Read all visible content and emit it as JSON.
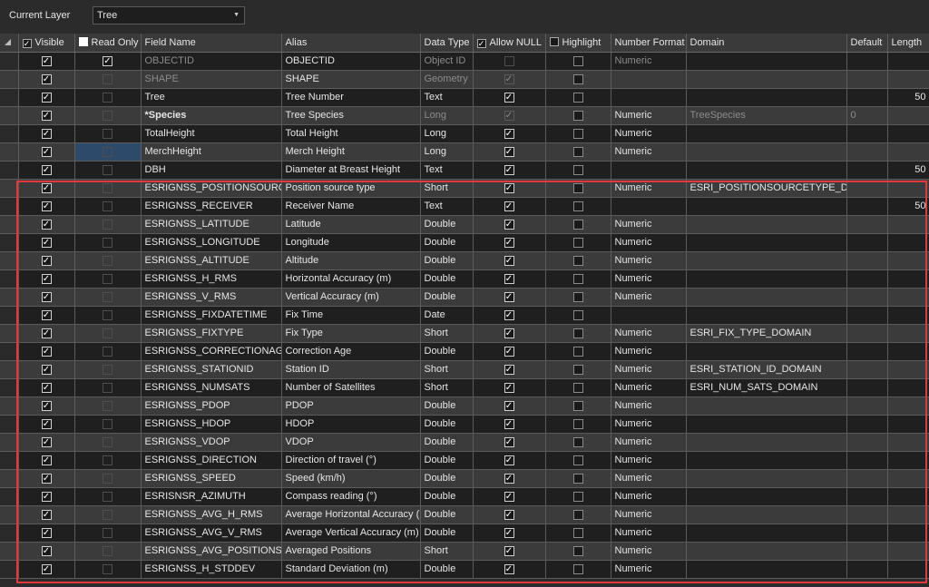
{
  "toolbar": {
    "current_layer_label": "Current Layer",
    "layer_value": "Tree",
    "dropdown_icon": "chevron-down-icon"
  },
  "columns": [
    {
      "key": "visible",
      "label": "Visible",
      "checkbox": "checked"
    },
    {
      "key": "readonly",
      "label": "Read Only",
      "checkbox": "filled"
    },
    {
      "key": "field",
      "label": "Field Name"
    },
    {
      "key": "alias",
      "label": "Alias"
    },
    {
      "key": "type",
      "label": "Data Type"
    },
    {
      "key": "allownull",
      "label": "Allow NULL",
      "checkbox": "checked"
    },
    {
      "key": "highlight",
      "label": "Highlight",
      "checkbox": "empty"
    },
    {
      "key": "numfmt",
      "label": "Number Format"
    },
    {
      "key": "domain",
      "label": "Domain"
    },
    {
      "key": "default",
      "label": "Default"
    },
    {
      "key": "length",
      "label": "Length"
    }
  ],
  "rows": [
    {
      "visible": true,
      "readonly": true,
      "readonly_disabled": false,
      "field": "OBJECTID",
      "field_muted": true,
      "alias": "OBJECTID",
      "type": "Object ID",
      "type_muted": true,
      "allownull": false,
      "allownull_disabled": true,
      "highlight": false,
      "numfmt": "Numeric",
      "numfmt_muted": true,
      "domain": "",
      "default": "",
      "length": ""
    },
    {
      "visible": true,
      "readonly": false,
      "readonly_disabled": true,
      "field": "SHAPE",
      "field_muted": true,
      "alias": "SHAPE",
      "type": "Geometry",
      "type_muted": true,
      "allownull": true,
      "allownull_disabled": true,
      "highlight": false,
      "numfmt": "",
      "domain": "",
      "default": "",
      "length": ""
    },
    {
      "visible": true,
      "readonly": false,
      "readonly_disabled": true,
      "field": "Tree",
      "alias": "Tree Number",
      "type": "Text",
      "allownull": true,
      "highlight": false,
      "numfmt": "",
      "domain": "",
      "default": "",
      "length": "50"
    },
    {
      "visible": true,
      "readonly": false,
      "readonly_disabled": true,
      "field": "*Species",
      "field_bold": true,
      "alias": "Tree Species",
      "type": "Long",
      "type_muted": true,
      "allownull": true,
      "allownull_disabled": true,
      "highlight": false,
      "numfmt": "Numeric",
      "domain": "TreeSpecies",
      "domain_muted": true,
      "default": "0",
      "default_muted": true,
      "length": ""
    },
    {
      "visible": true,
      "readonly": false,
      "readonly_disabled": true,
      "field": "TotalHeight",
      "alias": "Total Height",
      "type": "Long",
      "allownull": true,
      "highlight": false,
      "numfmt": "Numeric",
      "domain": "",
      "default": "",
      "length": ""
    },
    {
      "visible": true,
      "readonly": false,
      "readonly_disabled": true,
      "readonly_highlight": true,
      "field": "MerchHeight",
      "alias": "Merch Height",
      "type": "Long",
      "allownull": true,
      "highlight": false,
      "numfmt": "Numeric",
      "domain": "",
      "default": "",
      "length": ""
    },
    {
      "visible": true,
      "readonly": false,
      "readonly_disabled": true,
      "field": "DBH",
      "alias": "Diameter at Breast Height",
      "type": "Text",
      "allownull": true,
      "highlight": false,
      "numfmt": "",
      "domain": "",
      "default": "",
      "length": "50"
    },
    {
      "visible": true,
      "readonly": false,
      "readonly_disabled": true,
      "field": "ESRIGNSS_POSITIONSOURCETYPE",
      "alias": "Position source type",
      "type": "Short",
      "allownull": true,
      "highlight": false,
      "numfmt": "Numeric",
      "domain": "ESRI_POSITIONSOURCETYPE_DOMAIN",
      "default": "",
      "length": ""
    },
    {
      "visible": true,
      "readonly": false,
      "readonly_disabled": true,
      "field": "ESRIGNSS_RECEIVER",
      "alias": "Receiver Name",
      "type": "Text",
      "allownull": true,
      "highlight": false,
      "numfmt": "",
      "domain": "",
      "default": "",
      "length": "50"
    },
    {
      "visible": true,
      "readonly": false,
      "readonly_disabled": true,
      "field": "ESRIGNSS_LATITUDE",
      "alias": "Latitude",
      "type": "Double",
      "allownull": true,
      "highlight": false,
      "numfmt": "Numeric",
      "domain": "",
      "default": "",
      "length": ""
    },
    {
      "visible": true,
      "readonly": false,
      "readonly_disabled": true,
      "field": "ESRIGNSS_LONGITUDE",
      "alias": "Longitude",
      "type": "Double",
      "allownull": true,
      "highlight": false,
      "numfmt": "Numeric",
      "domain": "",
      "default": "",
      "length": ""
    },
    {
      "visible": true,
      "readonly": false,
      "readonly_disabled": true,
      "field": "ESRIGNSS_ALTITUDE",
      "alias": "Altitude",
      "type": "Double",
      "allownull": true,
      "highlight": false,
      "numfmt": "Numeric",
      "domain": "",
      "default": "",
      "length": ""
    },
    {
      "visible": true,
      "readonly": false,
      "readonly_disabled": true,
      "field": "ESRIGNSS_H_RMS",
      "alias": "Horizontal Accuracy (m)",
      "type": "Double",
      "allownull": true,
      "highlight": false,
      "numfmt": "Numeric",
      "domain": "",
      "default": "",
      "length": ""
    },
    {
      "visible": true,
      "readonly": false,
      "readonly_disabled": true,
      "field": "ESRIGNSS_V_RMS",
      "alias": "Vertical Accuracy (m)",
      "type": "Double",
      "allownull": true,
      "highlight": false,
      "numfmt": "Numeric",
      "domain": "",
      "default": "",
      "length": ""
    },
    {
      "visible": true,
      "readonly": false,
      "readonly_disabled": true,
      "field": "ESRIGNSS_FIXDATETIME",
      "alias": "Fix Time",
      "type": "Date",
      "allownull": true,
      "highlight": false,
      "numfmt": "",
      "domain": "",
      "default": "",
      "length": ""
    },
    {
      "visible": true,
      "readonly": false,
      "readonly_disabled": true,
      "field": "ESRIGNSS_FIXTYPE",
      "alias": "Fix Type",
      "type": "Short",
      "allownull": true,
      "highlight": false,
      "numfmt": "Numeric",
      "domain": "ESRI_FIX_TYPE_DOMAIN",
      "default": "",
      "length": ""
    },
    {
      "visible": true,
      "readonly": false,
      "readonly_disabled": true,
      "field": "ESRIGNSS_CORRECTIONAGE",
      "alias": "Correction Age",
      "type": "Double",
      "allownull": true,
      "highlight": false,
      "numfmt": "Numeric",
      "domain": "",
      "default": "",
      "length": ""
    },
    {
      "visible": true,
      "readonly": false,
      "readonly_disabled": true,
      "field": "ESRIGNSS_STATIONID",
      "alias": "Station ID",
      "type": "Short",
      "allownull": true,
      "highlight": false,
      "numfmt": "Numeric",
      "domain": "ESRI_STATION_ID_DOMAIN",
      "default": "",
      "length": ""
    },
    {
      "visible": true,
      "readonly": false,
      "readonly_disabled": true,
      "field": "ESRIGNSS_NUMSATS",
      "alias": "Number of Satellites",
      "type": "Short",
      "allownull": true,
      "highlight": false,
      "numfmt": "Numeric",
      "domain": "ESRI_NUM_SATS_DOMAIN",
      "default": "",
      "length": ""
    },
    {
      "visible": true,
      "readonly": false,
      "readonly_disabled": true,
      "field": "ESRIGNSS_PDOP",
      "alias": "PDOP",
      "type": "Double",
      "allownull": true,
      "highlight": false,
      "numfmt": "Numeric",
      "domain": "",
      "default": "",
      "length": ""
    },
    {
      "visible": true,
      "readonly": false,
      "readonly_disabled": true,
      "field": "ESRIGNSS_HDOP",
      "alias": "HDOP",
      "type": "Double",
      "allownull": true,
      "highlight": false,
      "numfmt": "Numeric",
      "domain": "",
      "default": "",
      "length": ""
    },
    {
      "visible": true,
      "readonly": false,
      "readonly_disabled": true,
      "field": "ESRIGNSS_VDOP",
      "alias": "VDOP",
      "type": "Double",
      "allownull": true,
      "highlight": false,
      "numfmt": "Numeric",
      "domain": "",
      "default": "",
      "length": ""
    },
    {
      "visible": true,
      "readonly": false,
      "readonly_disabled": true,
      "field": "ESRIGNSS_DIRECTION",
      "alias": "Direction of travel (°)",
      "type": "Double",
      "allownull": true,
      "highlight": false,
      "numfmt": "Numeric",
      "domain": "",
      "default": "",
      "length": ""
    },
    {
      "visible": true,
      "readonly": false,
      "readonly_disabled": true,
      "field": "ESRIGNSS_SPEED",
      "alias": "Speed (km/h)",
      "type": "Double",
      "allownull": true,
      "highlight": false,
      "numfmt": "Numeric",
      "domain": "",
      "default": "",
      "length": ""
    },
    {
      "visible": true,
      "readonly": false,
      "readonly_disabled": true,
      "field": "ESRISNSR_AZIMUTH",
      "alias": "Compass reading (°)",
      "type": "Double",
      "allownull": true,
      "highlight": false,
      "numfmt": "Numeric",
      "domain": "",
      "default": "",
      "length": ""
    },
    {
      "visible": true,
      "readonly": false,
      "readonly_disabled": true,
      "field": "ESRIGNSS_AVG_H_RMS",
      "alias": "Average Horizontal Accuracy (m)",
      "type": "Double",
      "allownull": true,
      "highlight": false,
      "numfmt": "Numeric",
      "domain": "",
      "default": "",
      "length": ""
    },
    {
      "visible": true,
      "readonly": false,
      "readonly_disabled": true,
      "field": "ESRIGNSS_AVG_V_RMS",
      "alias": "Average Vertical Accuracy (m)",
      "type": "Double",
      "allownull": true,
      "highlight": false,
      "numfmt": "Numeric",
      "domain": "",
      "default": "",
      "length": ""
    },
    {
      "visible": true,
      "readonly": false,
      "readonly_disabled": true,
      "field": "ESRIGNSS_AVG_POSITIONS",
      "alias": "Averaged Positions",
      "type": "Short",
      "allownull": true,
      "highlight": false,
      "numfmt": "Numeric",
      "domain": "",
      "default": "",
      "length": ""
    },
    {
      "visible": true,
      "readonly": false,
      "readonly_disabled": true,
      "field": "ESRIGNSS_H_STDDEV",
      "alias": "Standard Deviation (m)",
      "type": "Double",
      "allownull": true,
      "highlight": false,
      "numfmt": "Numeric",
      "domain": "",
      "default": "",
      "length": ""
    }
  ],
  "colors": {
    "callout_border": "#e0393e",
    "row_dark": "#1f1f1f",
    "row_light": "#3b3b3b",
    "selected_cell": "#2d4a6b"
  }
}
